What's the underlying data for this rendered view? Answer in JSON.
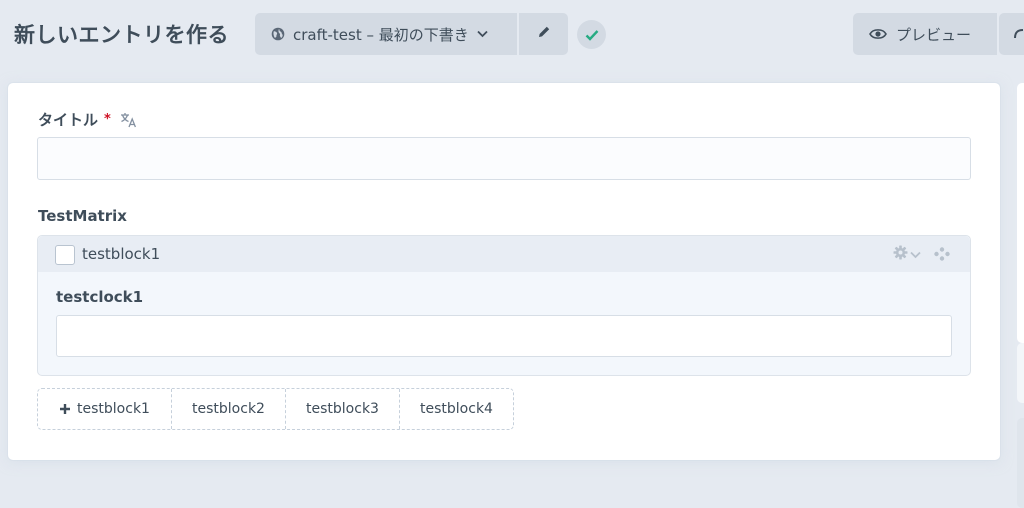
{
  "header": {
    "title": "新しいエントリを作る",
    "site_button_label": "craft-test – 最初の下書き",
    "preview_label": "プレビュー"
  },
  "fields": {
    "title_label": "タイトル",
    "title_required_mark": "*",
    "title_value": "",
    "matrix_label": "TestMatrix"
  },
  "block": {
    "title": "testblock1",
    "inner_field_label": "testclock1",
    "inner_field_value": ""
  },
  "add_buttons": [
    {
      "label": "testblock1"
    },
    {
      "label": "testblock2"
    },
    {
      "label": "testblock3"
    },
    {
      "label": "testblock4"
    }
  ],
  "colors": {
    "background": "#e5eaf1",
    "button": "#d3dae3",
    "status_ok": "#27ab83",
    "required": "#cf1124"
  },
  "icons": [
    "globe-icon",
    "chevron-down-icon",
    "pencil-icon",
    "check-icon",
    "eye-icon",
    "translate-icon",
    "gear-icon",
    "move-icon",
    "plus-icon"
  ]
}
